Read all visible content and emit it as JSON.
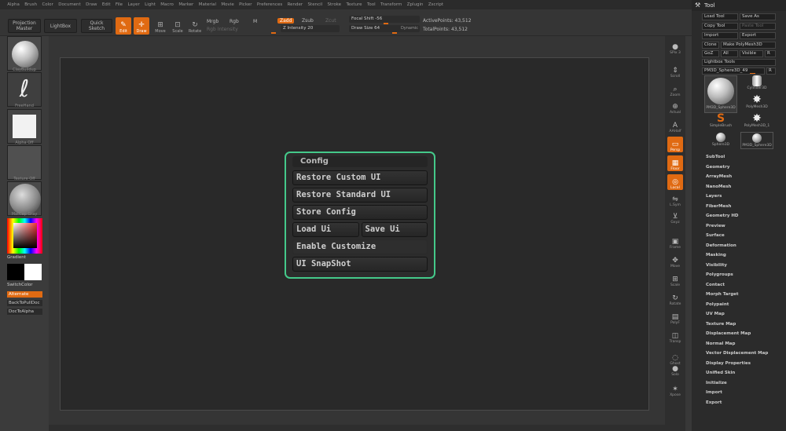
{
  "menubar": [
    "Alpha",
    "Brush",
    "Color",
    "Document",
    "Draw",
    "Edit",
    "File",
    "Layer",
    "Light",
    "Macro",
    "Marker",
    "Material",
    "Movie",
    "Picker",
    "Preferences",
    "Render",
    "Stencil",
    "Stroke",
    "Texture",
    "Tool",
    "Transform",
    "Zplugin",
    "Zscript"
  ],
  "shelf": {
    "projection_master": "Projection Master",
    "lightbox": "LightBox",
    "quick_sketch": "Quick Sketch",
    "tools": [
      "Edit",
      "Draw",
      "Move",
      "Scale",
      "Rotate"
    ],
    "mrgb": "Mrgb",
    "rgb": "Rgb",
    "m": "M",
    "rgb_intensity": "Rgb Intensity",
    "zadd": "Zadd",
    "zsub": "Zsub",
    "zcut": "Zcut",
    "z_intensity": "Z Intensity 20",
    "focal_shift": "Focal Shift -56",
    "draw_size": "Draw Size 64",
    "dynamic": "Dynamic",
    "active_points": "ActivePoints: 43,512",
    "total_points": "TotalPoints: 43,512"
  },
  "lefttray": {
    "brush": "ClayBuildup",
    "stroke": "FreeHand",
    "alpha": "Alpha Off",
    "texture": "Texture Off",
    "material": "MatCap Gray",
    "gradient": "Gradient",
    "switchcolor": "SwitchColor",
    "alternate": "Alternate",
    "backtopulldoc": "BackToPullDoc",
    "doctoalpha": "DocToAlpha"
  },
  "config": {
    "title": "Config",
    "restore_custom": "Restore Custom UI",
    "restore_standard": "Restore Standard UI",
    "store_config": "Store Config",
    "load_ui": "Load Ui",
    "save_ui": "Save Ui",
    "enable_customize": "Enable Customize",
    "ui_snapshot": "UI SnapShot"
  },
  "rightshelf": [
    "SPix 3",
    "Scroll",
    "Zoom",
    "Actual",
    "AAHalf",
    "Persp",
    "Floor",
    "Local",
    "L.Sym",
    "Gxyz",
    "Frame",
    "Move",
    "Scale",
    "Rotate",
    "PolyF",
    "Transp",
    "Ghost",
    "Solo",
    "Xpose"
  ],
  "tool": {
    "header": "Tool",
    "load_tool": "Load Tool",
    "save_as": "Save As",
    "copy_tool": "Copy Tool",
    "paste_tool": "Paste Tool",
    "import": "Import",
    "export": "Export",
    "clone": "Clone",
    "make_polymesh": "Make PolyMesh3D",
    "goz": "GoZ",
    "all": "All",
    "visible": "Visible",
    "r": "R",
    "lightbox_tools": "Lightbox Tools",
    "current_tool": "PM3D_Sphere3D_49",
    "r2": "R",
    "thumbs": [
      "PM3D_Sphere3D",
      "Cylinder3D",
      "PolyMesh3D",
      "SimpleBrush",
      "PolyMesh3D_1",
      "Sphere3D",
      "PM3D_Sphere3D"
    ],
    "sections": [
      "SubTool",
      "Geometry",
      "ArrayMesh",
      "NanoMesh",
      "Layers",
      "FiberMesh",
      "Geometry HD",
      "Preview",
      "Surface",
      "Deformation",
      "Masking",
      "Visibility",
      "Polygroups",
      "Contact",
      "Morph Target",
      "Polypaint",
      "UV Map",
      "Texture Map",
      "Displacement Map",
      "Normal Map",
      "Vector Displacement Map",
      "Display Properties",
      "Unified Skin",
      "Initialize",
      "Import",
      "Export"
    ]
  },
  "colors": {
    "accent": "#e06a12",
    "highlight": "#44c98a"
  }
}
